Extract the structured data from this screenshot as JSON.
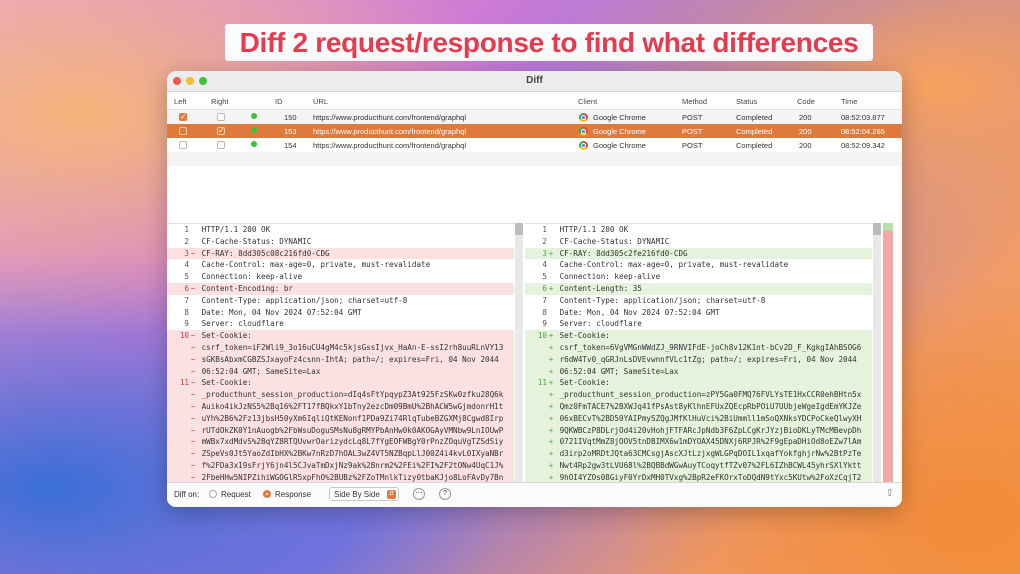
{
  "banner": "Diff 2 request/response to find what differences",
  "window_title": "Diff",
  "columns": {
    "left": "Left",
    "right": "Right",
    "id": "ID",
    "url": "URL",
    "client": "Client",
    "method": "Method",
    "status": "Status",
    "code": "Code",
    "time": "Time"
  },
  "rows": [
    {
      "left": true,
      "right": false,
      "id": "150",
      "url": "https://www.producthunt.com/frontend/graphql",
      "client": "Google Chrome",
      "method": "POST",
      "status": "Completed",
      "code": "200",
      "time": "08:52:03.877"
    },
    {
      "left": false,
      "right": true,
      "id": "153",
      "url": "https://www.producthunt.com/frontend/graphql",
      "client": "Google Chrome",
      "method": "POST",
      "status": "Completed",
      "code": "200",
      "time": "08:52:04.265"
    },
    {
      "left": false,
      "right": false,
      "id": "154",
      "url": "https://www.producthunt.com/frontend/graphql",
      "client": "Google Chrome",
      "method": "POST",
      "status": "Completed",
      "code": "200",
      "time": "08:52:09.342"
    }
  ],
  "left_pane": [
    {
      "n": "1",
      "t": "HTTP/1.1 200 OK",
      "k": ""
    },
    {
      "n": "2",
      "t": "CF-Cache-Status: DYNAMIC",
      "k": ""
    },
    {
      "n": "3",
      "t": "CF-RAY: 8dd305c08c216fd0-CDG",
      "k": "del"
    },
    {
      "n": "4",
      "t": "Cache-Control: max-age=0, private, must-revalidate",
      "k": ""
    },
    {
      "n": "5",
      "t": "Connection: keep-alive",
      "k": ""
    },
    {
      "n": "6",
      "t": "Content-Encoding: br",
      "k": "del"
    },
    {
      "n": "7",
      "t": "Content-Type: application/json; charset=utf-8",
      "k": ""
    },
    {
      "n": "8",
      "t": "Date: Mon, 04 Nov 2024 07:52:04 GMT",
      "k": ""
    },
    {
      "n": "9",
      "t": "Server: cloudflare",
      "k": ""
    },
    {
      "n": "10",
      "t": "Set-Cookie:",
      "k": "del"
    },
    {
      "n": "",
      "t": "csrf_token=iF2Wli9_3o16uCU4gM4c5kjsGssIjvx_HaAn-E-ssI2rh8uuRLnVY13",
      "k": "del"
    },
    {
      "n": "",
      "t": "sGKBsAbxmCGBZSJxayoFz4csnn-IhtA; path=/; expires=Fri, 04 Nov 2044",
      "k": "del"
    },
    {
      "n": "",
      "t": "06:52:04 GMT; SameSite=Lax",
      "k": "del"
    },
    {
      "n": "11",
      "t": "Set-Cookie:",
      "k": "del"
    },
    {
      "n": "",
      "t": "_producthunt_session_production=dIq4sFtYpqypZ3At925FzSKw0zfku28Q6k",
      "k": "del"
    },
    {
      "n": "",
      "t": "Auiko4ikJzNS5%2Bq16%2FT17fBQkxY1bTny2ezcDm09BmU%2BhACW5wGjmdonrH1t",
      "k": "del"
    },
    {
      "n": "",
      "t": "uYh%2B6%2Fz13jbsH50yXm6IqliQtKENonf1PDa9Zi74RlqTubeBZGXMj8Cgwd8Irp",
      "k": "del"
    },
    {
      "n": "",
      "t": "rUTdOkZK0Y1nAuogb%2FbWsuDoguSMsNu8gRMYPbAnHw0k0AKOGAyVMNbw9LnIOUwP",
      "k": "del"
    },
    {
      "n": "",
      "t": "mWBx7xdMdvS%2BqYZ8RTQUvwrOarizydcLq8L7fYgEOFWBgY0rPnzZOquVgTZSdSiy",
      "k": "del"
    },
    {
      "n": "",
      "t": "ZSpeVs0Jt5YaoZdIbHX%2BKw7nRzD7hOAL3wZ4VT5NZBqpLlJ00Z4i4kvL0IXyaNBr",
      "k": "del"
    },
    {
      "n": "",
      "t": "f%2FDa3x19sFrjY6jn4l5CJvaTmDxjNz9ak%2Bnrm2%2FEi%2FI%2F2tONw4UqC1J%",
      "k": "del"
    },
    {
      "n": "",
      "t": "2FbeHHw5NIPZihiWGOGlR5xpFhO%2BUBz%2FZoTMnlkTizy0tbaKJjo8LoFAvDy7Bn",
      "k": "del"
    }
  ],
  "right_pane": [
    {
      "n": "1",
      "t": "HTTP/1.1 200 OK",
      "k": ""
    },
    {
      "n": "2",
      "t": "CF-Cache-Status: DYNAMIC",
      "k": ""
    },
    {
      "n": "3",
      "t": "CF-RAY: 8dd305c2fe216fd0-CDG",
      "k": "ins"
    },
    {
      "n": "4",
      "t": "Cache-Control: max-age=0, private, must-revalidate",
      "k": ""
    },
    {
      "n": "5",
      "t": "Connection: keep-alive",
      "k": ""
    },
    {
      "n": "6",
      "t": "Content-Length: 35",
      "k": "ins"
    },
    {
      "n": "7",
      "t": "Content-Type: application/json; charset=utf-8",
      "k": ""
    },
    {
      "n": "8",
      "t": "Date: Mon, 04 Nov 2024 07:52:04 GMT",
      "k": ""
    },
    {
      "n": "9",
      "t": "Server: cloudflare",
      "k": ""
    },
    {
      "n": "10",
      "t": "Set-Cookie:",
      "k": "ins"
    },
    {
      "n": "",
      "t": "csrf_token=6VgVMGnWWdZJ_9RNVIFdE-joCh8v12K1nt-bCv2D_F_KgkgIAhBSOG6",
      "k": "ins"
    },
    {
      "n": "",
      "t": "r6dW4Tv0_qGRJnLsDVEvwnnfVLc1tZg; path=/; expires=Fri, 04 Nov 2044",
      "k": "ins"
    },
    {
      "n": "",
      "t": "06:52:04 GMT; SameSite=Lax",
      "k": "ins"
    },
    {
      "n": "11",
      "t": "Set-Cookie:",
      "k": "ins"
    },
    {
      "n": "",
      "t": "_producthunt_session_production=zPY5Ga0FMQ76FVLYsTE1HxCCR0ehBHtn5x",
      "k": "ins"
    },
    {
      "n": "",
      "t": "Qmz0FmTACE7%2BXWJq41fPsAst8yKlhnEFUxZQEcpRbPOiU7UUbjeWgeIgdEmYKJZe",
      "k": "ins"
    },
    {
      "n": "",
      "t": "06xBECvT%2BD50YAIPmySZQgJMfKlHuVci%2BiUmmll1mSoQXNksYDCPoCkeQlwyXH",
      "k": "ins"
    },
    {
      "n": "",
      "t": "9QKWBCzP8DLrjOd4i20vHohjFTFARcJpNdb3F6ZpLCgKrJYzjBioDKLyTMcMBevpDh",
      "k": "ins"
    },
    {
      "n": "",
      "t": "0721IVqtMmZ8jOOV5tnDBIMX6w1mDYOAX45DNXj6RPJR%2F9gEpaDHiOd8oEZw7lAm",
      "k": "ins"
    },
    {
      "n": "",
      "t": "d3irp2oMRDtJQta63CMCsgjAscXJtLzjxgWLGPqDOIL1xqafYokfghjrNw%2BtPzTe",
      "k": "ins"
    },
    {
      "n": "",
      "t": "Nwt4Rp2gw3tLVU68l%2BQBBdWGwAuyTCoqytfTZv07%2FL6IZhBCWL45yhrSXlYktt",
      "k": "ins"
    },
    {
      "n": "",
      "t": "9hOI4YZOs08GiyF0YrDxMH0TVxg%2BpR2eFKOrxToDQdN9tYxc5KUtw%2FoXzCqjT2",
      "k": "ins"
    }
  ],
  "footer": {
    "diff_on": "Diff on:",
    "request": "Request",
    "response": "Response",
    "view_mode": "Side By Side",
    "selected": "response"
  }
}
